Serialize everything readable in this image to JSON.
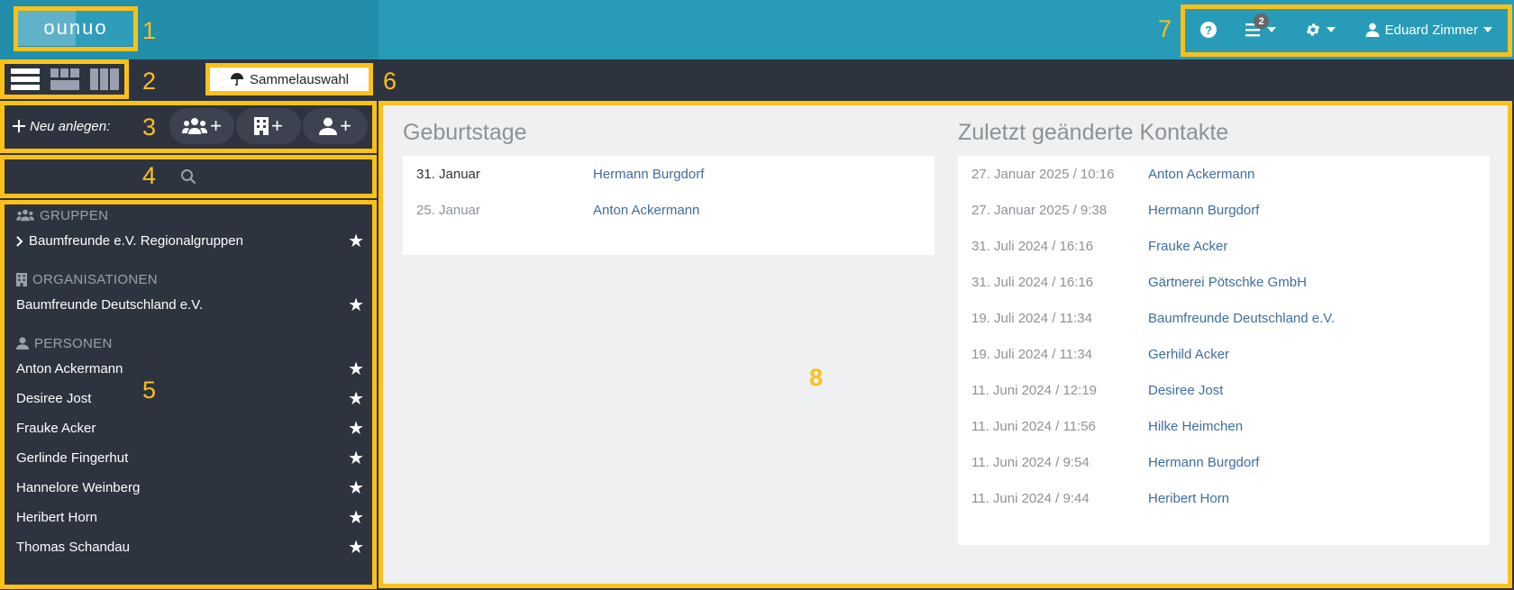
{
  "header": {
    "logo_text": "ounuo",
    "help_label": "?",
    "menu_badge": "2",
    "user_name": "Eduard Zimmer"
  },
  "toolbar": {
    "sammelauswahl_label": "Sammelauswahl",
    "neu_anlegen_label": "Neu anlegen:"
  },
  "sidebar": {
    "groups_title": "GRUPPEN",
    "groups": [
      {
        "label": "Baumfreunde e.V. Regionalgruppen"
      }
    ],
    "orgs_title": "ORGANISATIONEN",
    "orgs": [
      {
        "label": "Baumfreunde Deutschland e.V."
      }
    ],
    "persons_title": "PERSONEN",
    "persons": [
      {
        "label": "Anton Ackermann"
      },
      {
        "label": "Desiree Jost"
      },
      {
        "label": "Frauke Acker"
      },
      {
        "label": "Gerlinde Fingerhut"
      },
      {
        "label": "Hannelore Weinberg"
      },
      {
        "label": "Heribert Horn"
      },
      {
        "label": "Thomas Schandau"
      }
    ]
  },
  "birthdays": {
    "title": "Geburtstage",
    "rows": [
      {
        "date": "31. Januar",
        "name": "Hermann Burgdorf"
      },
      {
        "date": "25. Januar",
        "name": "Anton Ackermann"
      }
    ]
  },
  "recent": {
    "title": "Zuletzt geänderte Kontakte",
    "rows": [
      {
        "date": "27. Januar 2025 / 10:16",
        "name": "Anton Ackermann"
      },
      {
        "date": "27. Januar 2025 / 9:38",
        "name": "Hermann Burgdorf"
      },
      {
        "date": "31. Juli 2024 / 16:16",
        "name": "Frauke Acker"
      },
      {
        "date": "31. Juli 2024 / 16:16",
        "name": "Gärtnerei Pötschke GmbH"
      },
      {
        "date": "19. Juli 2024 / 11:34",
        "name": "Baumfreunde Deutschland e.V."
      },
      {
        "date": "19. Juli 2024 / 11:34",
        "name": "Gerhild Acker"
      },
      {
        "date": "11. Juni 2024 / 12:19",
        "name": "Desiree Jost"
      },
      {
        "date": "11. Juni 2024 / 11:56",
        "name": "Hilke Heimchen"
      },
      {
        "date": "11. Juni 2024 / 9:54",
        "name": "Hermann Burgdorf"
      },
      {
        "date": "11. Juni 2024 / 9:44",
        "name": "Heribert Horn"
      }
    ]
  },
  "annotations": [
    "1",
    "2",
    "3",
    "4",
    "5",
    "6",
    "7",
    "8"
  ]
}
